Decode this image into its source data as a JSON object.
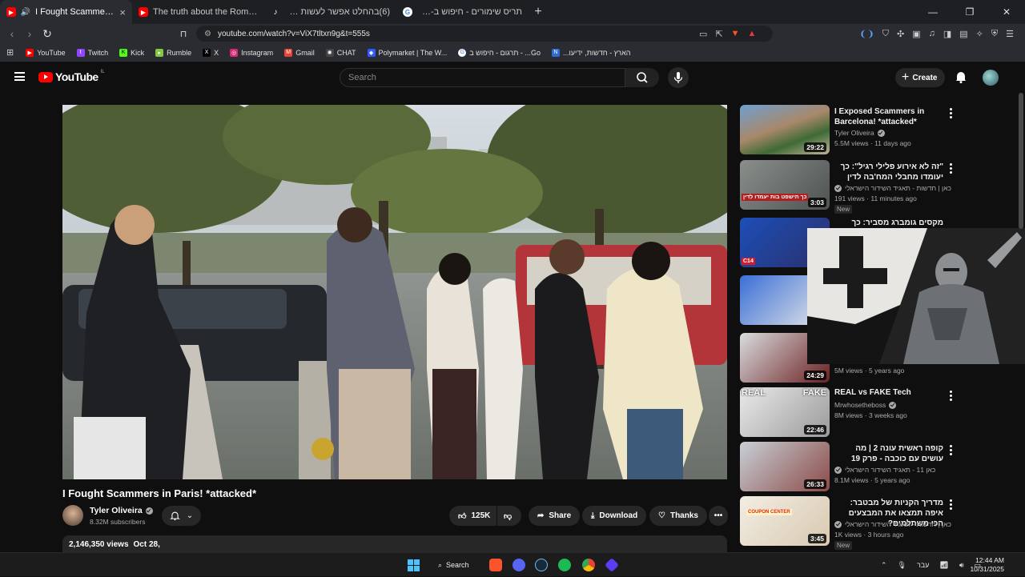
{
  "browser": {
    "tabs": [
      {
        "title": "I Fought Scammers in Paris! *",
        "icon": "youtube-icon",
        "active": true
      },
      {
        "title": "The truth about the Roman salute #h",
        "icon": "youtube-icon",
        "active": false
      },
      {
        "title": "(6)בהחלט אפשר לעשות מעשים חמ...",
        "icon": "tiktok-icon",
        "active": false
      },
      {
        "title": "תריס שימורים - חיפוש ב-Google",
        "icon": "google-icon",
        "active": false
      }
    ],
    "url": "youtube.com/watch?v=ViX7tltxn9g&t=555s",
    "bookmarks": [
      {
        "label": "YouTube",
        "icon": "youtube-icon",
        "color": "#ff0000"
      },
      {
        "label": "Twitch",
        "icon": "twitch-icon",
        "color": "#9146ff"
      },
      {
        "label": "Kick",
        "icon": "kick-icon",
        "color": "#53fc18"
      },
      {
        "label": "Rumble",
        "icon": "rumble-icon",
        "color": "#85c742"
      },
      {
        "label": "X",
        "icon": "x-icon",
        "color": "#000000"
      },
      {
        "label": "Instagram",
        "icon": "instagram-icon",
        "color": "#d62976"
      },
      {
        "label": "Gmail",
        "icon": "gmail-icon",
        "color": "#ea4335"
      },
      {
        "label": "CHAT",
        "icon": "chatgpt-icon",
        "color": "#444444"
      },
      {
        "label": "Polymarket | The W...",
        "icon": "polymarket-icon",
        "color": "#2e5bff"
      },
      {
        "label": "Go... - תרגום - חיפוש ב",
        "icon": "google-icon",
        "color": "#ffffff"
      },
      {
        "label": "הארץ - חדשות, ידיעו...",
        "icon": "haaretz-icon",
        "color": "#2b6cd6"
      }
    ]
  },
  "youtube": {
    "logo_text": "YouTube",
    "country_code": "IL",
    "search_placeholder": "Search",
    "create_label": "Create"
  },
  "video": {
    "title": "I Fought Scammers in Paris! *attacked*",
    "channel": "Tyler Oliveira",
    "subscribers": "8.32M subscribers",
    "likes": "125K",
    "share_label": "Share",
    "download_label": "Download",
    "thanks_label": "Thanks",
    "views": "2,146,350 views",
    "date": "Oct 28,"
  },
  "related": [
    {
      "title": "I Exposed Scammers in Barcelona! *attacked*",
      "channel": "Tyler Oliveira",
      "verified": true,
      "meta": "5.5M views · 11 days ago",
      "duration": "29:22",
      "rtl": false,
      "new": false
    },
    {
      "title": "\"זה לא אירוע פלילי רגיל\": כך יעומדו מחבלי המח'בה לדין",
      "channel": "כאן | חדשות - תאגיד השידור הישראלי",
      "verified": true,
      "meta": "191 views · 11 minutes ago",
      "duration": "3:03",
      "rtl": true,
      "new": true,
      "thumb_caption": "כך תישפט בות יעמדו לדין"
    },
    {
      "title": "מקסים גומברג מסביר: כך תטמיע",
      "channel": "",
      "verified": false,
      "meta": "",
      "duration": "",
      "rtl": true,
      "new": false,
      "thumb_caption": "C14"
    },
    {
      "title": "",
      "channel": "",
      "verified": false,
      "meta": "",
      "duration": "",
      "rtl": false,
      "new": false
    },
    {
      "title": "",
      "channel": "",
      "verified": false,
      "meta": "5M views · 5 years ago",
      "duration": "24:29",
      "rtl": false,
      "new": false
    },
    {
      "title": "REAL vs FAKE Tech",
      "channel": "Mrwhosetheboss",
      "verified": true,
      "meta": "8M views · 3 weeks ago",
      "duration": "22:46",
      "rtl": false,
      "new": false,
      "thumb_caption": "REAL FAKE"
    },
    {
      "title": "קופה ראשית עונה 2 | מה עושים עם כוכבה - פרק 19",
      "channel": "כאן 11 - תאגיד השידור הישראלי",
      "verified": true,
      "meta": "8.1M views · 5 years ago",
      "duration": "26:33",
      "rtl": true,
      "new": false
    },
    {
      "title": "מדריך הקניות של מבטבר: איפה תמצאו את המבצעים הכי משתלמים?",
      "channel": "כאן | חדשות - תאגיד השידור הישראלי",
      "verified": true,
      "meta": "1K views · 3 hours ago",
      "duration": "3:45",
      "rtl": true,
      "new": true,
      "thumb_caption": "COUPON CENTER"
    }
  ],
  "new_badge": "New",
  "taskbar": {
    "search_label": "Search",
    "language": "עבר",
    "time": "12:44 AM",
    "date": "10/31/2025"
  },
  "colors": {
    "accent": "#ff0000",
    "background": "#0f0f0f",
    "chip": "#272727"
  }
}
